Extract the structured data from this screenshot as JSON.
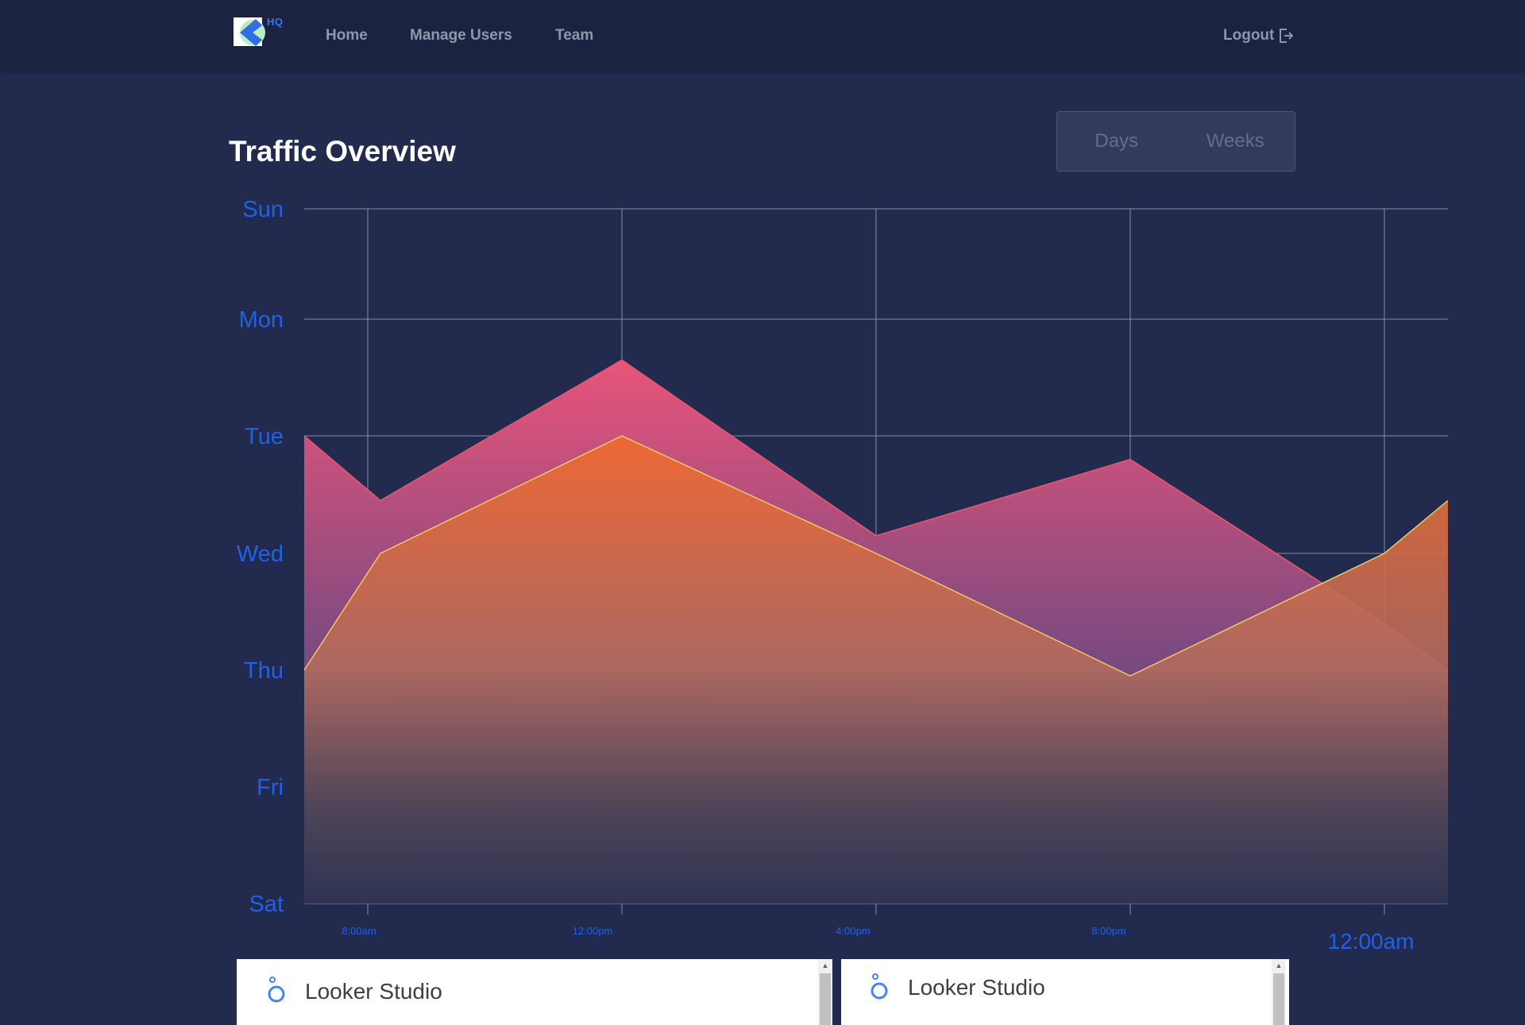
{
  "nav": {
    "logo_text": "HQ",
    "links": [
      "Home",
      "Manage Users",
      "Team"
    ],
    "logout": "Logout"
  },
  "page_title": "Traffic Overview",
  "toggle": {
    "days": "Days",
    "weeks": "Weeks"
  },
  "chart_data": {
    "type": "area",
    "title": "",
    "xlabel": "",
    "ylabel": "",
    "y_categories": [
      "Sun",
      "Mon",
      "Tue",
      "Wed",
      "Thu",
      "Fri",
      "Sat"
    ],
    "x_tick_labels": [
      "8:00am",
      "12:00pm",
      "4:00pm",
      "8:00pm",
      "12:00am"
    ],
    "x_tick_hours": [
      8,
      12,
      16,
      20,
      24
    ],
    "xlim": [
      7,
      25
    ],
    "ylim_index": [
      0,
      6
    ],
    "grid": true,
    "series": [
      {
        "color": "#e2546f",
        "x": [
          7,
          8.2,
          12,
          16,
          20,
          24,
          25
        ],
        "y": [
          2.0,
          2.55,
          1.35,
          2.85,
          2.2,
          3.6,
          4.0
        ]
      },
      {
        "color": "#f06f36",
        "x": [
          7,
          8.2,
          12,
          16,
          20,
          24,
          25
        ],
        "y": [
          4.0,
          3.0,
          2.0,
          3.0,
          4.05,
          3.0,
          2.55
        ]
      }
    ]
  },
  "embeds": [
    {
      "title": "Looker Studio"
    },
    {
      "title": "Looker Studio"
    }
  ]
}
